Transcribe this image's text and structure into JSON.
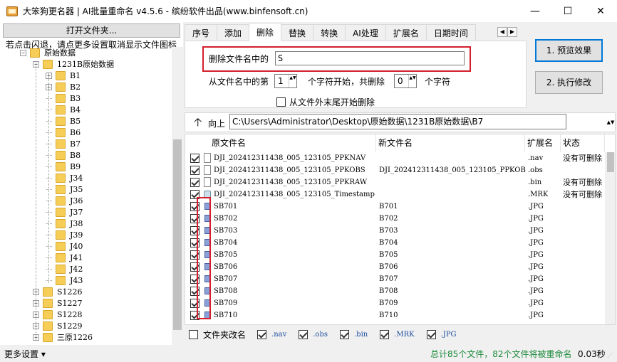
{
  "titlebar": {
    "title": "大笨狗更名器 | AI批量重命名 v4.5.6 - 缤纷软件出品(www.binfensoft.cn)",
    "minimize": "—",
    "maximize": "☐",
    "close": "✕"
  },
  "left": {
    "open_folder": "打开文件夹...",
    "hint": "若点击闪退，请点更多设置取消显示文件图标",
    "tree": [
      {
        "label": "原始数据",
        "level": 1,
        "expander": "−"
      },
      {
        "label": "1231B原始数据",
        "level": 2,
        "expander": "−"
      },
      {
        "label": "B1",
        "level": 3,
        "expander": "+"
      },
      {
        "label": "B2",
        "level": 3,
        "expander": "+"
      },
      {
        "label": "B3",
        "level": 3,
        "expander": ""
      },
      {
        "label": "B4",
        "level": 3,
        "expander": ""
      },
      {
        "label": "B5",
        "level": 3,
        "expander": ""
      },
      {
        "label": "B6",
        "level": 3,
        "expander": ""
      },
      {
        "label": "B7",
        "level": 3,
        "expander": ""
      },
      {
        "label": "B8",
        "level": 3,
        "expander": ""
      },
      {
        "label": "B9",
        "level": 3,
        "expander": ""
      },
      {
        "label": "J34",
        "level": 3,
        "expander": ""
      },
      {
        "label": "J35",
        "level": 3,
        "expander": ""
      },
      {
        "label": "J36",
        "level": 3,
        "expander": ""
      },
      {
        "label": "J37",
        "level": 3,
        "expander": ""
      },
      {
        "label": "J38",
        "level": 3,
        "expander": ""
      },
      {
        "label": "J39",
        "level": 3,
        "expander": ""
      },
      {
        "label": "J40",
        "level": 3,
        "expander": ""
      },
      {
        "label": "J41",
        "level": 3,
        "expander": ""
      },
      {
        "label": "J42",
        "level": 3,
        "expander": ""
      },
      {
        "label": "J43",
        "level": 3,
        "expander": ""
      },
      {
        "label": "S1226",
        "level": 2,
        "expander": "+"
      },
      {
        "label": "S1227",
        "level": 2,
        "expander": "+"
      },
      {
        "label": "S1228",
        "level": 2,
        "expander": "+"
      },
      {
        "label": "S1229",
        "level": 2,
        "expander": "+"
      },
      {
        "label": "三原1226",
        "level": 2,
        "expander": "+"
      }
    ]
  },
  "tabs": [
    {
      "label": "序号"
    },
    {
      "label": "添加"
    },
    {
      "label": "删除",
      "active": true
    },
    {
      "label": "替换"
    },
    {
      "label": "转换"
    },
    {
      "label": "AI处理"
    },
    {
      "label": "扩展名"
    },
    {
      "label": "日期时间"
    }
  ],
  "tab_arrows": {
    "left": "◀",
    "right": "▶"
  },
  "delete_panel": {
    "delete_label": "删除文件名中的",
    "delete_value": "S",
    "from_label": "从文件名中的第",
    "start_value": "1",
    "mid_label": "个字符开始，共删除",
    "count_value": "0",
    "end_label": "个字符",
    "spin_arrows": "▲▼",
    "from_end_label": "从文件外末尾开始删除"
  },
  "actions": {
    "preview": "1. 预览效果",
    "execute": "2. 执行修改"
  },
  "pathbar": {
    "up_icon": "🡡",
    "up_label": "向上",
    "path": "C:\\Users\\Administrator\\Desktop\\原始数据\\1231B原始数据\\B7",
    "scroll": "▲▼"
  },
  "filelist": {
    "headers": {
      "orig": "原文件名",
      "new": "新文件名",
      "ext": "扩展名",
      "status": "状态"
    },
    "rows": [
      {
        "orig": "DJI_202412311438_005_123105_PPKNAV",
        "new": "",
        "ext": ".nav",
        "status": "没有可删除",
        "icon": "doc"
      },
      {
        "orig": "DJI_202412311438_005_123105_PPKOBS",
        "new": "DJI_202412311438_005_123105_PPKOB",
        "ext": ".obs",
        "status": "",
        "icon": "doc"
      },
      {
        "orig": "DJI_202412311438_005_123105_PPKRAW",
        "new": "",
        "ext": ".bin",
        "status": "没有可删除",
        "icon": "doc"
      },
      {
        "orig": "DJI_202412311438_005_123105_Timestamp",
        "new": "",
        "ext": ".MRK",
        "status": "没有可删除",
        "icon": "ts"
      },
      {
        "orig": "SB701",
        "new": "B701",
        "ext": ".JPG",
        "status": "",
        "icon": "img"
      },
      {
        "orig": "SB702",
        "new": "B702",
        "ext": ".JPG",
        "status": "",
        "icon": "img"
      },
      {
        "orig": "SB703",
        "new": "B703",
        "ext": ".JPG",
        "status": "",
        "icon": "img"
      },
      {
        "orig": "SB704",
        "new": "B704",
        "ext": ".JPG",
        "status": "",
        "icon": "img"
      },
      {
        "orig": "SB705",
        "new": "B705",
        "ext": ".JPG",
        "status": "",
        "icon": "img"
      },
      {
        "orig": "SB706",
        "new": "B706",
        "ext": ".JPG",
        "status": "",
        "icon": "img"
      },
      {
        "orig": "SB707",
        "new": "B707",
        "ext": ".JPG",
        "status": "",
        "icon": "img"
      },
      {
        "orig": "SB708",
        "new": "B708",
        "ext": ".JPG",
        "status": "",
        "icon": "img"
      },
      {
        "orig": "SB709",
        "new": "B709",
        "ext": ".JPG",
        "status": "",
        "icon": "img"
      },
      {
        "orig": "SB710",
        "new": "B710",
        "ext": ".JPG",
        "status": "",
        "icon": "img"
      }
    ]
  },
  "filters": {
    "folder_rename": "文件夹改名",
    "exts": [
      ".nav",
      ".obs",
      ".bin",
      ".MRK",
      ".JPG"
    ]
  },
  "status": {
    "more_settings": "更多设置 ▾",
    "summary": "总计85个文件，82个文件将被重命名",
    "time": "0.03秒",
    "grip": "⋰"
  }
}
